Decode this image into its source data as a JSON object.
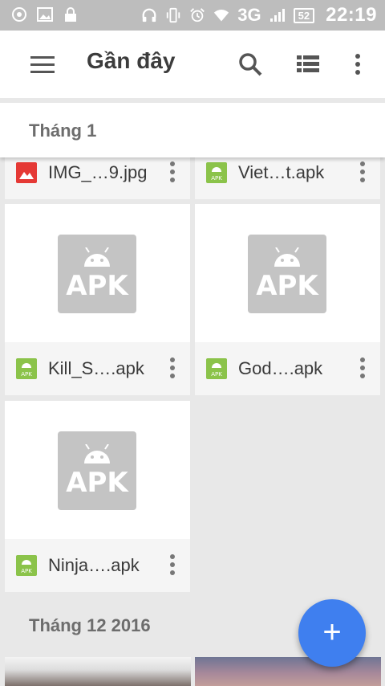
{
  "status_bar": {
    "network": "3G",
    "battery": "52",
    "time": "22:19"
  },
  "app_bar": {
    "title": "Gần đây"
  },
  "sections": [
    {
      "label": "Tháng 1"
    },
    {
      "label": "Tháng 12 2016"
    }
  ],
  "files": [
    {
      "name": "IMG_…9.jpg",
      "type": "image"
    },
    {
      "name": "Viet…t.apk",
      "type": "apk"
    },
    {
      "name": "Kill_S….apk",
      "type": "apk"
    },
    {
      "name": "God….apk",
      "type": "apk"
    },
    {
      "name": "Ninja….apk",
      "type": "apk"
    }
  ],
  "thumb_label": "APK",
  "fab_label": "+",
  "colors": {
    "accent": "#3f7fef",
    "apk_green": "#8bc34a",
    "image_red": "#e53935",
    "statusbar": "#bdbdbd"
  }
}
